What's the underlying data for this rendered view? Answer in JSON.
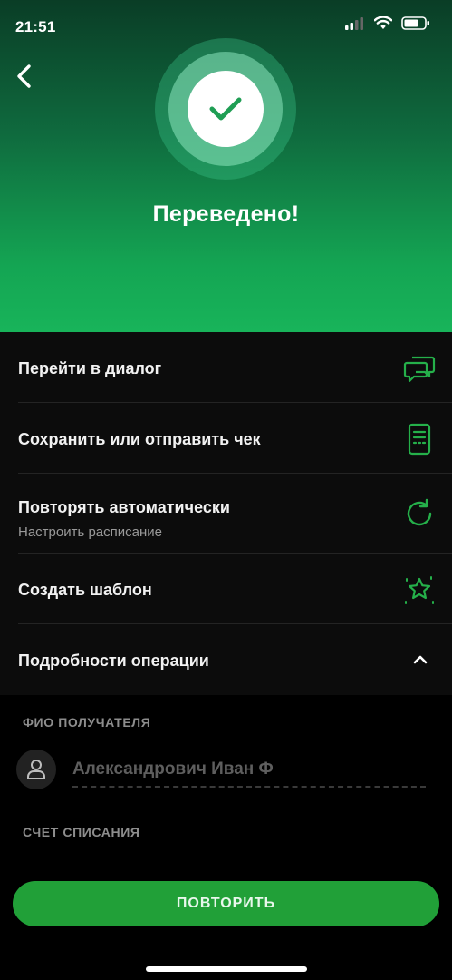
{
  "status_bar": {
    "time": "21:51"
  },
  "header": {
    "title": "Переведено!"
  },
  "actions": [
    {
      "label": "Перейти в диалог",
      "icon": "chat-bubbles-icon"
    },
    {
      "label": "Сохранить или отправить чек",
      "icon": "receipt-icon"
    },
    {
      "label": "Повторять автоматически",
      "sublabel": "Настроить расписание",
      "icon": "repeat-icon"
    },
    {
      "label": "Создать шаблон",
      "icon": "star-icon"
    }
  ],
  "details": {
    "label": "Подробности операции",
    "recipient_section": "ФИО ПОЛУЧАТЕЛЯ",
    "recipient_name": "Александрович Иван Ф",
    "account_section": "СЧЕТ СПИСАНИЯ"
  },
  "cta": {
    "label": "ПОВТОРИТЬ"
  },
  "colors": {
    "accent": "#21a038",
    "icon_green": "#25b04a",
    "background": "#0c0c0c"
  }
}
